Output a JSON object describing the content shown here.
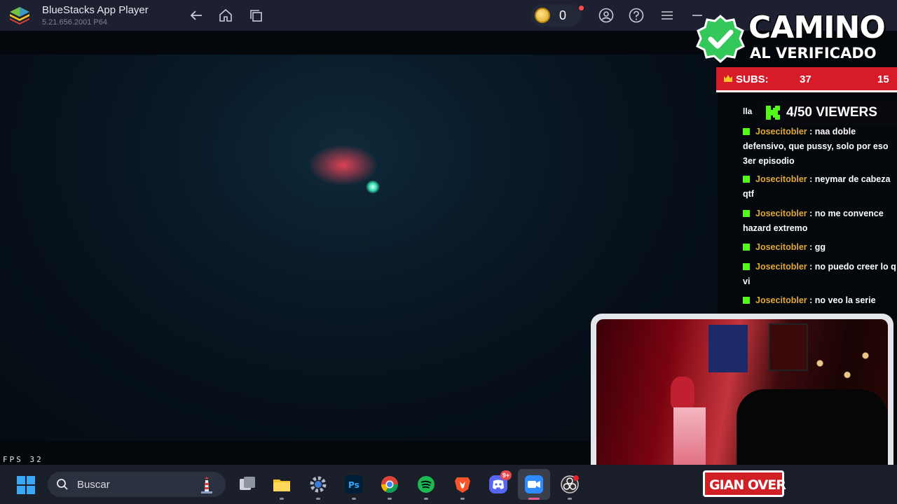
{
  "titlebar": {
    "app_name": "BlueStacks App Player",
    "version": "5.21.656.2001 P64",
    "coins": "0"
  },
  "game": {
    "fps_label": "FPS",
    "fps_value": "32"
  },
  "overlay": {
    "title_line1": "CAMINO",
    "title_line2": "AL VERIFICADO",
    "subs_label": "SUBS:",
    "subs_current": "37",
    "subs_goal": "15",
    "viewers": "4/50 VIEWERS",
    "streamer_name": "GIAN OVER"
  },
  "chat": {
    "cut_line": "lla",
    "messages": [
      {
        "user": "Josecitobler",
        "text": "naa doble defensivo, que pussy, solo por eso 3er episodio"
      },
      {
        "user": "Josecitobler",
        "text": "neymar de cabeza qtf"
      },
      {
        "user": "Josecitobler",
        "text": "no me convence hazard extremo"
      },
      {
        "user": "Josecitobler",
        "text": "gg"
      },
      {
        "user": "Josecitobler",
        "text": "no puedo creer lo q vi"
      },
      {
        "user": "Josecitobler",
        "text": "no veo la serie"
      }
    ]
  },
  "taskbar": {
    "search_placeholder": "Buscar",
    "discord_badge": "9+"
  },
  "colors": {
    "titlebar_bg": "#1c2030",
    "subs_red": "#d81b28",
    "kick_green": "#53fc18",
    "chat_user": "#e0a83a"
  }
}
